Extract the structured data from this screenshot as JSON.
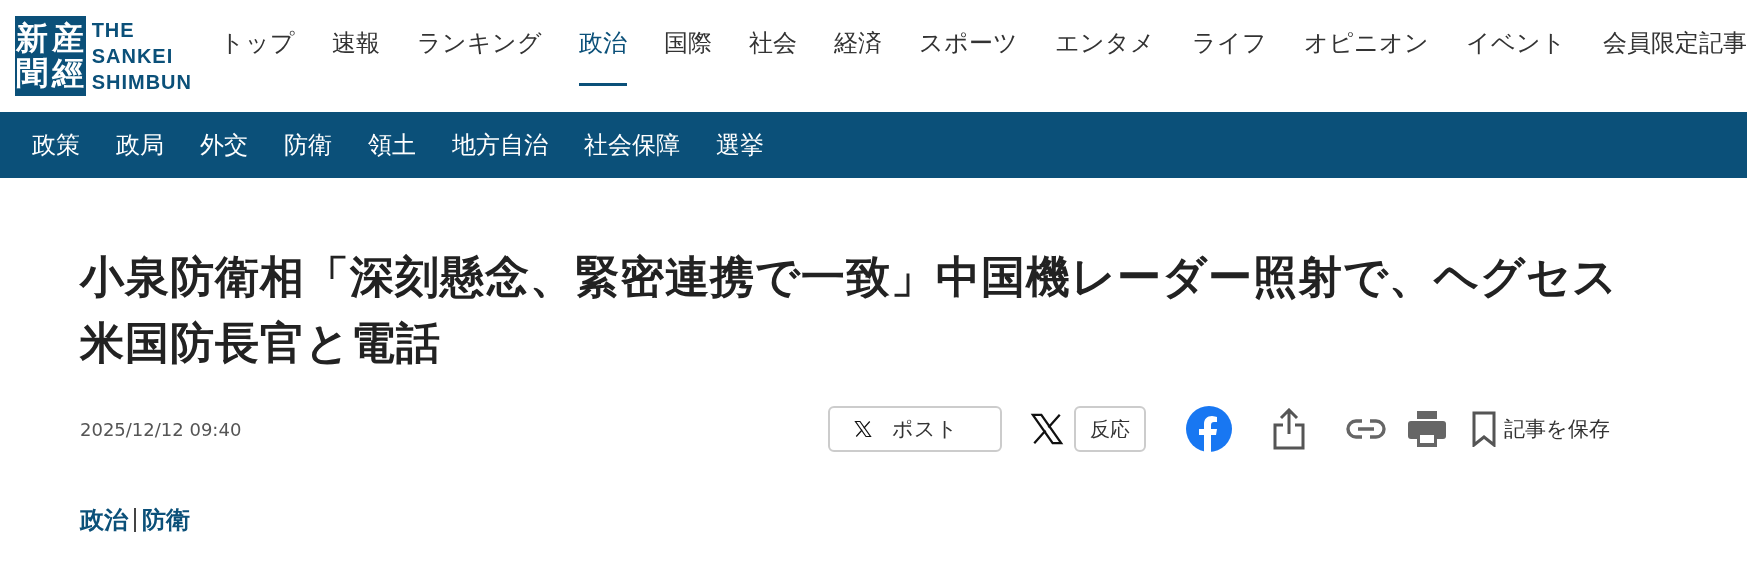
{
  "logo": {
    "seal_columns": [
      "新聞",
      "産經"
    ],
    "wordmark": [
      "THE",
      "SANKEI",
      "SHIMBUN"
    ]
  },
  "main_nav": [
    {
      "label": "トップ",
      "selected": false
    },
    {
      "label": "速報",
      "selected": false
    },
    {
      "label": "ランキング",
      "selected": false
    },
    {
      "label": "政治",
      "selected": true
    },
    {
      "label": "国際",
      "selected": false
    },
    {
      "label": "社会",
      "selected": false
    },
    {
      "label": "経済",
      "selected": false
    },
    {
      "label": "スポーツ",
      "selected": false
    },
    {
      "label": "エンタメ",
      "selected": false
    },
    {
      "label": "ライフ",
      "selected": false
    },
    {
      "label": "オピニオン",
      "selected": false
    },
    {
      "label": "イベント",
      "selected": false
    },
    {
      "label": "会員限定記事",
      "selected": false
    }
  ],
  "sub_nav": [
    "政策",
    "政局",
    "外交",
    "防衛",
    "領土",
    "地方自治",
    "社会保障",
    "選挙"
  ],
  "article": {
    "headline": "小泉防衛相「深刻懸念、緊密連携で一致」中国機レーダー照射で、ヘグセス米国防長官と電話",
    "date": "2025/12/12 09:40",
    "share": {
      "post_label": "ポスト",
      "reaction_label": "反応",
      "save_label": "記事を保存"
    },
    "categories": [
      "政治",
      "防衛"
    ]
  }
}
